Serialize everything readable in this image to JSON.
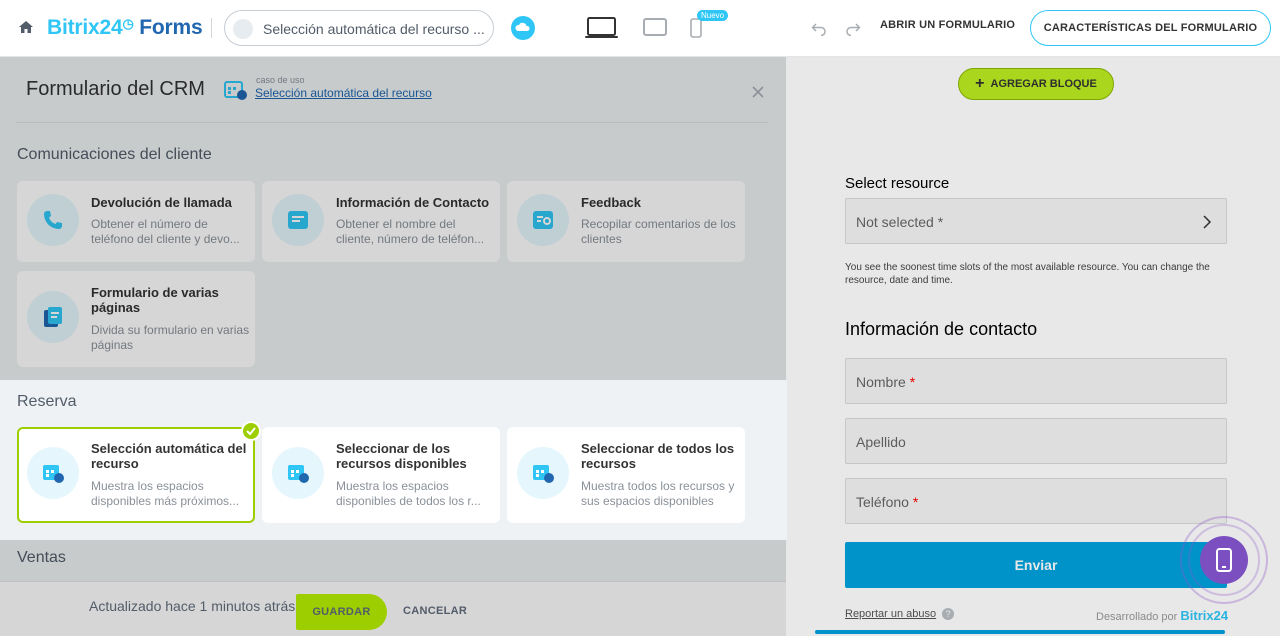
{
  "topbar": {
    "brand": "Bitrix24",
    "brand_suffix": "Forms",
    "scenario_pill": "Selección automática del recurso ...",
    "new_badge": "Nuevo",
    "open_form": "ABRIR UN FORMULARIO",
    "features": "CARACTERÍSTICAS DEL FORMULARIO"
  },
  "panel": {
    "title": "Formulario del CRM",
    "use_case_label": "caso de uso",
    "use_case_link": "Selección automática del recurso"
  },
  "sections": {
    "communications": {
      "title": "Comunicaciones del cliente",
      "cards": [
        {
          "title": "Devolución de llamada",
          "desc": "Obtener el número de teléfono del cliente y devo..."
        },
        {
          "title": "Información de Contacto",
          "desc": "Obtener el nombre del cliente, número de teléfon..."
        },
        {
          "title": "Feedback",
          "desc": "Recopilar comentarios de los clientes"
        },
        {
          "title": "Formulario de varias páginas",
          "desc": "Divida su formulario en varias páginas"
        }
      ]
    },
    "reserve": {
      "title": "Reserva",
      "cards": [
        {
          "title": "Selección automática del recurso",
          "desc": "Muestra los espacios disponibles más próximos..."
        },
        {
          "title": "Seleccionar de los recursos disponibles",
          "desc": "Muestra los espacios disponibles de todos los r..."
        },
        {
          "title": "Seleccionar de todos los recursos",
          "desc": "Muestra todos los recursos y sus espacios disponibles"
        }
      ]
    },
    "sales": {
      "title": "Ventas"
    }
  },
  "bottom": {
    "updated": "Actualizado hace 1 minutos atrás",
    "save": "GUARDAR",
    "cancel": "CANCELAR"
  },
  "preview": {
    "add_block": "AGREGAR BLOQUE",
    "select_resource_label": "Select resource",
    "select_resource_placeholder": "Not selected",
    "help_text": "You see the soonest time slots of the most available resource. You can change the resource, date and time.",
    "contact_heading": "Información de contacto",
    "fields": [
      {
        "label": "Nombre",
        "required": "*"
      },
      {
        "label": "Apellido",
        "required": ""
      },
      {
        "label": "Teléfono",
        "required": "*"
      }
    ],
    "required_mark": "*",
    "submit": "Enviar",
    "report": "Reportar un abuso",
    "help_icon_glyph": "?",
    "powered_by": "Desarrollado por",
    "powered_brand": "Bitrix24"
  },
  "colors": {
    "accent": "#2fc6f6",
    "brand_dark": "#2067b0",
    "green": "#9dcf00",
    "submit": "#00a2df",
    "fab": "#7b4fc0"
  }
}
